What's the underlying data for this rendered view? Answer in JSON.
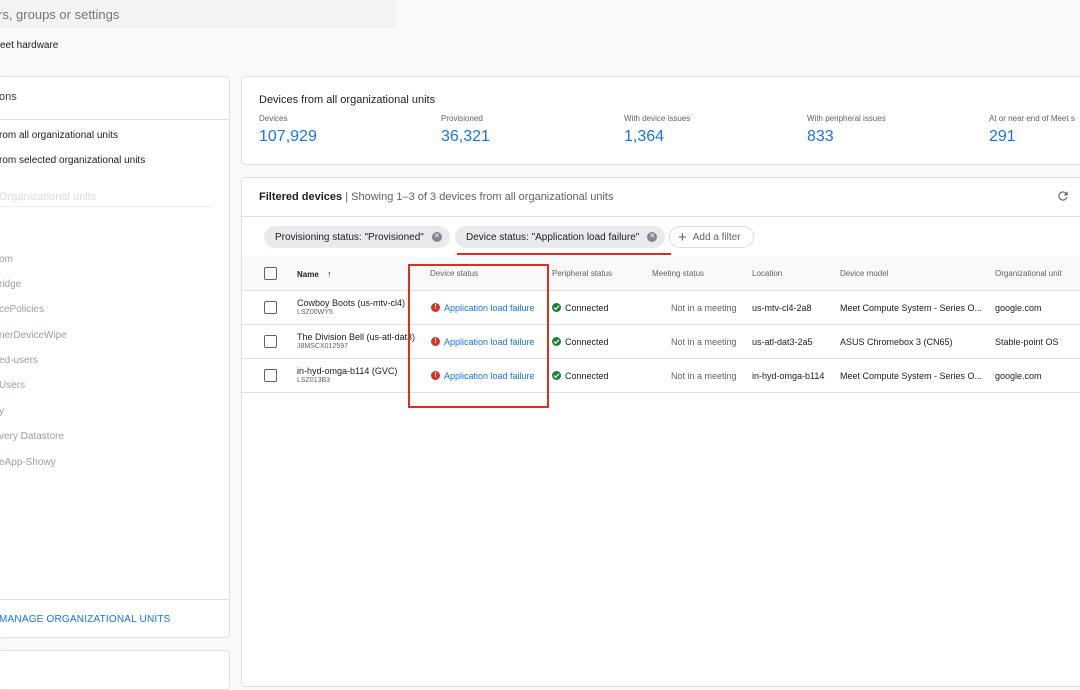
{
  "search": {
    "placeholder": "rs, groups or settings"
  },
  "breadcrumb": {
    "text": "eet hardware"
  },
  "left_panel": {
    "title": "ons",
    "options": [
      "rom all organizational units",
      "rom selected organizational units"
    ],
    "ou_header": "Organizational units",
    "ou_items": [
      "",
      "om",
      "ridge",
      "cePolicies",
      "nerDeviceWipe",
      "ed-users",
      "Users",
      "y",
      "very Datastore",
      "eApp-Showy"
    ],
    "manage_label": "MANAGE ORGANIZATIONAL UNITS"
  },
  "summary": {
    "title": "Devices from all organizational units",
    "stats": [
      {
        "label": "Devices",
        "value": "107,929"
      },
      {
        "label": "Provisioned",
        "value": "36,321"
      },
      {
        "label": "With device issues",
        "value": "1,364"
      },
      {
        "label": "With peripheral issues",
        "value": "833"
      },
      {
        "label": "At or near end of Meet s",
        "value": "291"
      }
    ]
  },
  "devices": {
    "title": "Filtered devices",
    "separator": " | ",
    "subtitle": "Showing 1–3 of 3 devices from all organizational units",
    "filters": [
      "Provisioning status: \"Provisioned\"",
      "Device status: \"Application load failure\""
    ],
    "add_filter": "Add a filter",
    "columns": {
      "name": "Name",
      "device_status": "Device status",
      "peripheral_status": "Peripheral status",
      "meeting_status": "Meeting status",
      "location": "Location",
      "device_model": "Device model",
      "org_unit": "Organizational unit"
    },
    "rows": [
      {
        "name": "Cowboy Boots (us-mtv-cl4)",
        "serial": "LSZ00WY5",
        "device_status": "Application load failure",
        "peripheral_status": "Connected",
        "meeting_status": "Not in a meeting",
        "location": "us-mtv-cl4-2a8",
        "device_model": "Meet Compute System - Series O...",
        "org_unit": "google.com"
      },
      {
        "name": "The Division Bell (us-atl-dat3)",
        "serial": "J8MSCX012597",
        "device_status": "Application load failure",
        "peripheral_status": "Connected",
        "meeting_status": "Not in a meeting",
        "location": "us-atl-dat3-2a5",
        "device_model": "ASUS Chromebox 3 (CN65)",
        "org_unit": "Stable-point OS"
      },
      {
        "name": "in-hyd-omga-b114 (GVC)",
        "serial": "LSZ013B3",
        "device_status": "Application load failure",
        "peripheral_status": "Connected",
        "meeting_status": "Not in a meeting",
        "location": "in-hyd-omga-b114",
        "device_model": "Meet Compute System - Series O...",
        "org_unit": "google.com"
      }
    ]
  },
  "colors": {
    "accent": "#1a73e8",
    "error": "#d93025",
    "success": "#188038"
  },
  "icons": {
    "sort": "arrow-up-icon",
    "refresh": "refresh-icon",
    "remove": "close-circle-icon",
    "add": "plus-icon",
    "error": "error-circle-icon",
    "ok": "check-circle-icon"
  }
}
